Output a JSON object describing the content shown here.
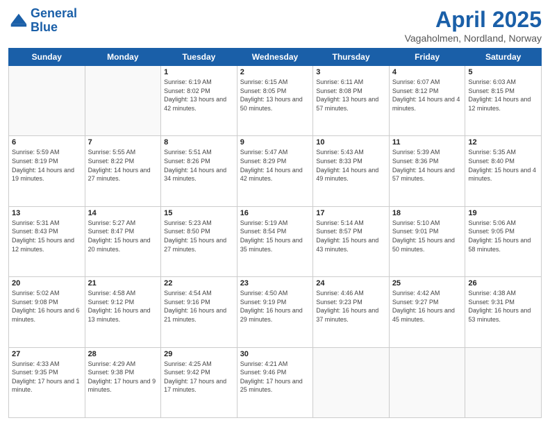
{
  "header": {
    "logo_line1": "General",
    "logo_line2": "Blue",
    "main_title": "April 2025",
    "subtitle": "Vagaholmen, Nordland, Norway"
  },
  "weekdays": [
    "Sunday",
    "Monday",
    "Tuesday",
    "Wednesday",
    "Thursday",
    "Friday",
    "Saturday"
  ],
  "weeks": [
    [
      {
        "day": "",
        "sunrise": "",
        "sunset": "",
        "daylight": ""
      },
      {
        "day": "",
        "sunrise": "",
        "sunset": "",
        "daylight": ""
      },
      {
        "day": "1",
        "sunrise": "Sunrise: 6:19 AM",
        "sunset": "Sunset: 8:02 PM",
        "daylight": "Daylight: 13 hours and 42 minutes."
      },
      {
        "day": "2",
        "sunrise": "Sunrise: 6:15 AM",
        "sunset": "Sunset: 8:05 PM",
        "daylight": "Daylight: 13 hours and 50 minutes."
      },
      {
        "day": "3",
        "sunrise": "Sunrise: 6:11 AM",
        "sunset": "Sunset: 8:08 PM",
        "daylight": "Daylight: 13 hours and 57 minutes."
      },
      {
        "day": "4",
        "sunrise": "Sunrise: 6:07 AM",
        "sunset": "Sunset: 8:12 PM",
        "daylight": "Daylight: 14 hours and 4 minutes."
      },
      {
        "day": "5",
        "sunrise": "Sunrise: 6:03 AM",
        "sunset": "Sunset: 8:15 PM",
        "daylight": "Daylight: 14 hours and 12 minutes."
      }
    ],
    [
      {
        "day": "6",
        "sunrise": "Sunrise: 5:59 AM",
        "sunset": "Sunset: 8:19 PM",
        "daylight": "Daylight: 14 hours and 19 minutes."
      },
      {
        "day": "7",
        "sunrise": "Sunrise: 5:55 AM",
        "sunset": "Sunset: 8:22 PM",
        "daylight": "Daylight: 14 hours and 27 minutes."
      },
      {
        "day": "8",
        "sunrise": "Sunrise: 5:51 AM",
        "sunset": "Sunset: 8:26 PM",
        "daylight": "Daylight: 14 hours and 34 minutes."
      },
      {
        "day": "9",
        "sunrise": "Sunrise: 5:47 AM",
        "sunset": "Sunset: 8:29 PM",
        "daylight": "Daylight: 14 hours and 42 minutes."
      },
      {
        "day": "10",
        "sunrise": "Sunrise: 5:43 AM",
        "sunset": "Sunset: 8:33 PM",
        "daylight": "Daylight: 14 hours and 49 minutes."
      },
      {
        "day": "11",
        "sunrise": "Sunrise: 5:39 AM",
        "sunset": "Sunset: 8:36 PM",
        "daylight": "Daylight: 14 hours and 57 minutes."
      },
      {
        "day": "12",
        "sunrise": "Sunrise: 5:35 AM",
        "sunset": "Sunset: 8:40 PM",
        "daylight": "Daylight: 15 hours and 4 minutes."
      }
    ],
    [
      {
        "day": "13",
        "sunrise": "Sunrise: 5:31 AM",
        "sunset": "Sunset: 8:43 PM",
        "daylight": "Daylight: 15 hours and 12 minutes."
      },
      {
        "day": "14",
        "sunrise": "Sunrise: 5:27 AM",
        "sunset": "Sunset: 8:47 PM",
        "daylight": "Daylight: 15 hours and 20 minutes."
      },
      {
        "day": "15",
        "sunrise": "Sunrise: 5:23 AM",
        "sunset": "Sunset: 8:50 PM",
        "daylight": "Daylight: 15 hours and 27 minutes."
      },
      {
        "day": "16",
        "sunrise": "Sunrise: 5:19 AM",
        "sunset": "Sunset: 8:54 PM",
        "daylight": "Daylight: 15 hours and 35 minutes."
      },
      {
        "day": "17",
        "sunrise": "Sunrise: 5:14 AM",
        "sunset": "Sunset: 8:57 PM",
        "daylight": "Daylight: 15 hours and 43 minutes."
      },
      {
        "day": "18",
        "sunrise": "Sunrise: 5:10 AM",
        "sunset": "Sunset: 9:01 PM",
        "daylight": "Daylight: 15 hours and 50 minutes."
      },
      {
        "day": "19",
        "sunrise": "Sunrise: 5:06 AM",
        "sunset": "Sunset: 9:05 PM",
        "daylight": "Daylight: 15 hours and 58 minutes."
      }
    ],
    [
      {
        "day": "20",
        "sunrise": "Sunrise: 5:02 AM",
        "sunset": "Sunset: 9:08 PM",
        "daylight": "Daylight: 16 hours and 6 minutes."
      },
      {
        "day": "21",
        "sunrise": "Sunrise: 4:58 AM",
        "sunset": "Sunset: 9:12 PM",
        "daylight": "Daylight: 16 hours and 13 minutes."
      },
      {
        "day": "22",
        "sunrise": "Sunrise: 4:54 AM",
        "sunset": "Sunset: 9:16 PM",
        "daylight": "Daylight: 16 hours and 21 minutes."
      },
      {
        "day": "23",
        "sunrise": "Sunrise: 4:50 AM",
        "sunset": "Sunset: 9:19 PM",
        "daylight": "Daylight: 16 hours and 29 minutes."
      },
      {
        "day": "24",
        "sunrise": "Sunrise: 4:46 AM",
        "sunset": "Sunset: 9:23 PM",
        "daylight": "Daylight: 16 hours and 37 minutes."
      },
      {
        "day": "25",
        "sunrise": "Sunrise: 4:42 AM",
        "sunset": "Sunset: 9:27 PM",
        "daylight": "Daylight: 16 hours and 45 minutes."
      },
      {
        "day": "26",
        "sunrise": "Sunrise: 4:38 AM",
        "sunset": "Sunset: 9:31 PM",
        "daylight": "Daylight: 16 hours and 53 minutes."
      }
    ],
    [
      {
        "day": "27",
        "sunrise": "Sunrise: 4:33 AM",
        "sunset": "Sunset: 9:35 PM",
        "daylight": "Daylight: 17 hours and 1 minute."
      },
      {
        "day": "28",
        "sunrise": "Sunrise: 4:29 AM",
        "sunset": "Sunset: 9:38 PM",
        "daylight": "Daylight: 17 hours and 9 minutes."
      },
      {
        "day": "29",
        "sunrise": "Sunrise: 4:25 AM",
        "sunset": "Sunset: 9:42 PM",
        "daylight": "Daylight: 17 hours and 17 minutes."
      },
      {
        "day": "30",
        "sunrise": "Sunrise: 4:21 AM",
        "sunset": "Sunset: 9:46 PM",
        "daylight": "Daylight: 17 hours and 25 minutes."
      },
      {
        "day": "",
        "sunrise": "",
        "sunset": "",
        "daylight": ""
      },
      {
        "day": "",
        "sunrise": "",
        "sunset": "",
        "daylight": ""
      },
      {
        "day": "",
        "sunrise": "",
        "sunset": "",
        "daylight": ""
      }
    ]
  ]
}
